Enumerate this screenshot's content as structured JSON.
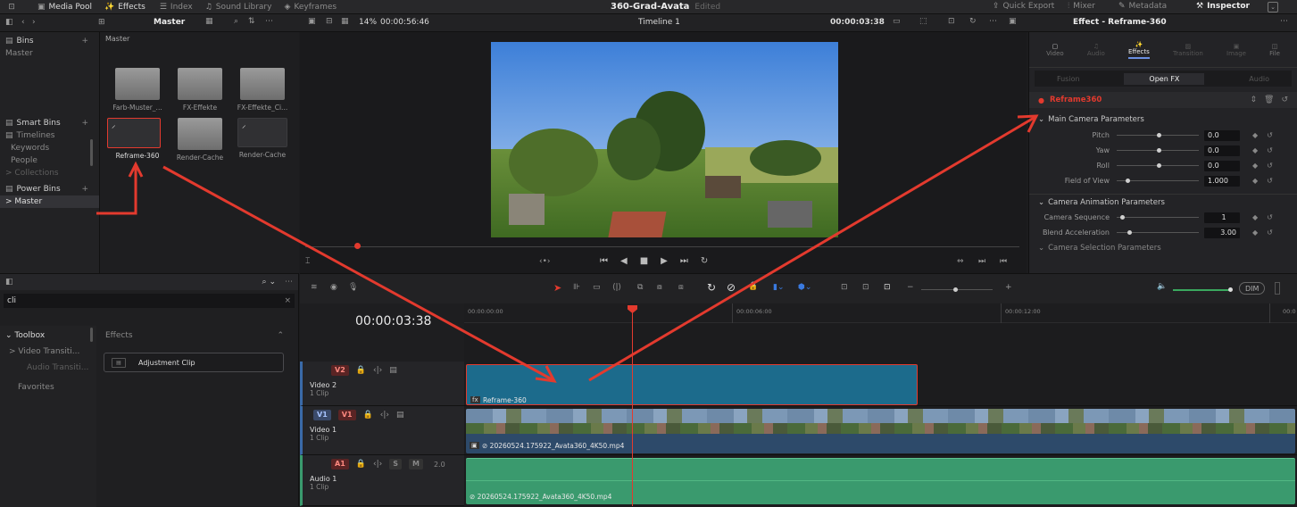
{
  "topbar": {
    "media_pool": "Media Pool",
    "effects": "Effects",
    "index": "Index",
    "sound_library": "Sound Library",
    "keyframes": "Keyframes",
    "project_title": "360-Grad-Avata",
    "project_status": "Edited",
    "quick_export": "Quick Export",
    "mixer": "Mixer",
    "metadata": "Metadata",
    "inspector": "Inspector"
  },
  "toolbar": {
    "master": "Master",
    "zoom": "14%",
    "duration": "00:00:56:46",
    "timeline_name": "Timeline 1",
    "timecode": "00:00:03:38",
    "effect_title": "Effect - Reframe-360"
  },
  "sidebar": {
    "bins": "Bins",
    "master": "Master",
    "smart_bins": "Smart Bins",
    "timelines": "Timelines",
    "keywords": "Keywords",
    "people": "People",
    "collections": "Collections",
    "power_bins": "Power Bins",
    "power_master": "Master"
  },
  "media": {
    "breadcrumb": "Master",
    "items": [
      {
        "label": "Farb-Muster_..."
      },
      {
        "label": "FX-Effekte"
      },
      {
        "label": "FX-Effekte_Ci..."
      },
      {
        "label": "Reframe-360"
      },
      {
        "label": "Render-Cache"
      },
      {
        "label": "Render-Cache"
      }
    ]
  },
  "effects_panel": {
    "search_value": "cli",
    "toolbox": "Toolbox",
    "video_transitions": "Video Transiti...",
    "audio_transitions": "Audio Transiti...",
    "favorites": "Favorites",
    "effects_header": "Effects",
    "adjustment_clip": "Adjustment Clip"
  },
  "timeline": {
    "timecode": "00:00:03:38",
    "ruler": [
      "00:00:00:00",
      "00:00:06:00",
      "00:00:12:00",
      "00:0"
    ],
    "dim": "DIM",
    "tracks": [
      {
        "tag": "V2",
        "name": "Video 2",
        "count": "1 Clip",
        "clip": "Reframe-360"
      },
      {
        "tag": "V1",
        "name": "Video 1",
        "count": "1 Clip",
        "clip": "20260524.175922_Avata360_4K50.mp4"
      },
      {
        "tag": "A1",
        "name": "Audio 1",
        "count": "1 Clip",
        "clip": "20260524.175922_Avata360_4K50.mp4",
        "level": "2.0"
      }
    ]
  },
  "inspector": {
    "tabs": [
      "Video",
      "Audio",
      "Effects",
      "Transition",
      "Image",
      "File"
    ],
    "subtabs": [
      "Fusion",
      "Open FX",
      "Audio"
    ],
    "effect_name": "Reframe360",
    "main_section": "Main Camera Parameters",
    "params": [
      {
        "label": "Pitch",
        "value": "0.0"
      },
      {
        "label": "Yaw",
        "value": "0.0"
      },
      {
        "label": "Roll",
        "value": "0.0"
      },
      {
        "label": "Field of View",
        "value": "1.000"
      }
    ],
    "anim_section": "Camera Animation Parameters",
    "anim_params": [
      {
        "label": "Camera Sequence",
        "value": "1"
      },
      {
        "label": "Blend Acceleration",
        "value": "3.00"
      }
    ],
    "selection_section": "Camera Selection Parameters"
  },
  "colors": {
    "accent_red": "#e33a2e",
    "clip_v2": "#1c6b8c",
    "audio_green": "#3a9a6e"
  }
}
